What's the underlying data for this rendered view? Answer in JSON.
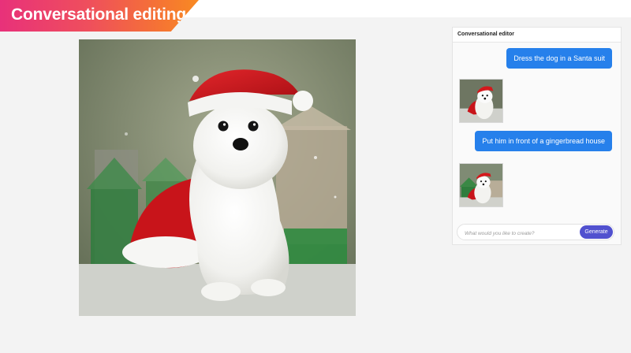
{
  "banner": {
    "title": "Conversational editing"
  },
  "canvas": {
    "subject": "white puppy wearing a Santa hat and Santa suit"
  },
  "panel": {
    "title": "Conversational editor",
    "messages": [
      {
        "role": "user",
        "text": "Dress the dog in a Santa suit"
      },
      {
        "role": "result",
        "image": "puppy-santa-suit-thumbnail"
      },
      {
        "role": "user",
        "text": "Put him in front of a gingerbread house"
      },
      {
        "role": "result",
        "image": "puppy-gingerbread-house-thumbnail"
      }
    ],
    "composer": {
      "placeholder": "What would you like to create?",
      "button_label": "Generate"
    }
  },
  "colors": {
    "accent_blue": "#2680eb",
    "generate_purple": "#5151cf",
    "banner_gradient_start": "#e8317a",
    "banner_gradient_end": "#f88a22",
    "santa_red": "#d4181c"
  }
}
